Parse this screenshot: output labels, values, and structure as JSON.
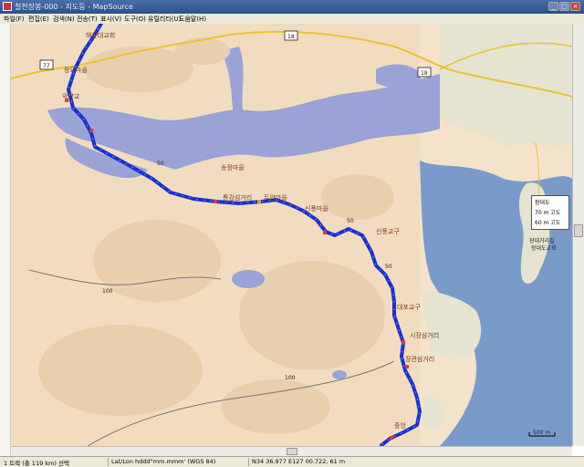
{
  "window": {
    "title": "칠천장봉-000 - 지도등 - MapSource"
  },
  "menu": [
    "파일(F)",
    "편집(E)",
    "검색(N)",
    "전송(T)",
    "표시(V)",
    "도구(O)",
    "유틸리티(U)",
    "도움말(H)"
  ],
  "map": {
    "route_labels": [
      "해운대교회",
      "왕묘마을",
      "악양교",
      "통감섬거리",
      "두암마을",
      "신풍마을",
      "송정마을",
      "신풍교구",
      "대포교구",
      "시장삼거리",
      "장관삼거리",
      "중앙"
    ],
    "road_numbers": [
      "18",
      "77",
      "18"
    ],
    "elevations": [
      "50",
      "100",
      "50",
      "100",
      "50"
    ],
    "island_label": "잠대도",
    "island_sub": [
      "장대거리길",
      "장대도교회"
    ],
    "popup": {
      "line1": "잠대도",
      "line2": "70 m 고도",
      "line3": "60 m 고도"
    },
    "scale": "500 m",
    "colors": {
      "route": "#1a2fd0",
      "water": "#9aa2d6",
      "sea": "#5b86bf",
      "land": "#f2dcc0"
    }
  },
  "status": {
    "selection": "1 트랙 (총 119 km) 선택",
    "format": "Lat/Lon hddd°mm.mmm' (WGS 84)",
    "coords": "N34 36.977 E127 00.722, 61 m"
  }
}
